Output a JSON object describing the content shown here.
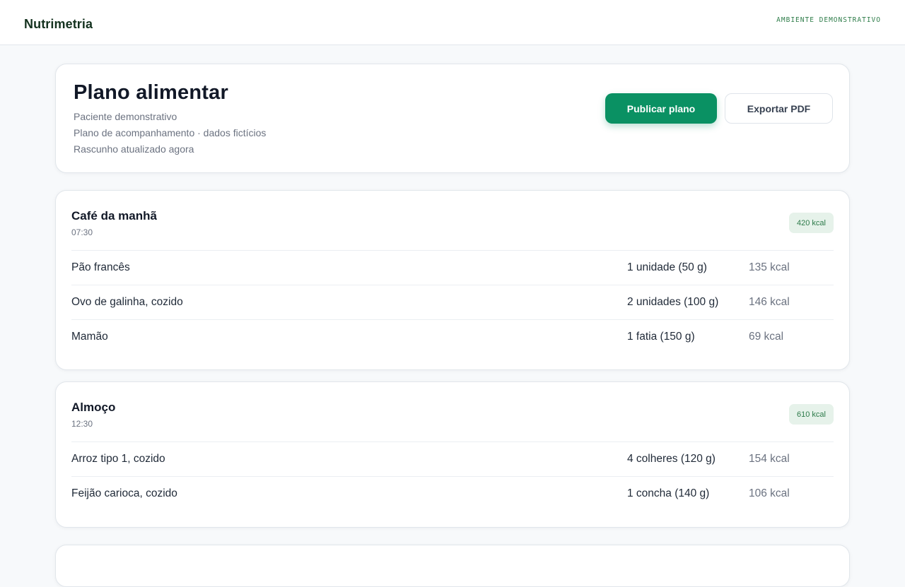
{
  "app": {
    "brand": "Nutrimetria",
    "environment": "AMBIENTE DEMONSTRATIVO"
  },
  "plan": {
    "title": "Plano alimentar",
    "patient": "Paciente demonstrativo",
    "subtitle": "Plano de acompanhamento · dados fictícios",
    "status": "Rascunho atualizado agora",
    "actions": {
      "publish": "Publicar plano",
      "export": "Exportar PDF"
    }
  },
  "meals": [
    {
      "name": "Café da manhã",
      "time": "07:30",
      "kcal": "420 kcal",
      "items": [
        {
          "food": "Pão francês",
          "qty": "1 unidade (50 g)",
          "kcal": "135 kcal"
        },
        {
          "food": "Ovo de galinha, cozido",
          "qty": "2 unidades (100 g)",
          "kcal": "146 kcal"
        },
        {
          "food": "Mamão",
          "qty": "1 fatia (150 g)",
          "kcal": "69 kcal"
        }
      ]
    },
    {
      "name": "Almoço",
      "time": "12:30",
      "kcal": "610 kcal",
      "items": [
        {
          "food": "Arroz tipo 1, cozido",
          "qty": "4 colheres (120 g)",
          "kcal": "154 kcal"
        },
        {
          "food": "Feijão carioca, cozido",
          "qty": "1 concha (140 g)",
          "kcal": "106 kcal"
        }
      ]
    }
  ],
  "colors": {
    "primary": "#0a9163",
    "badge_bg": "#e6f2ea",
    "badge_text": "#2c7a49"
  }
}
